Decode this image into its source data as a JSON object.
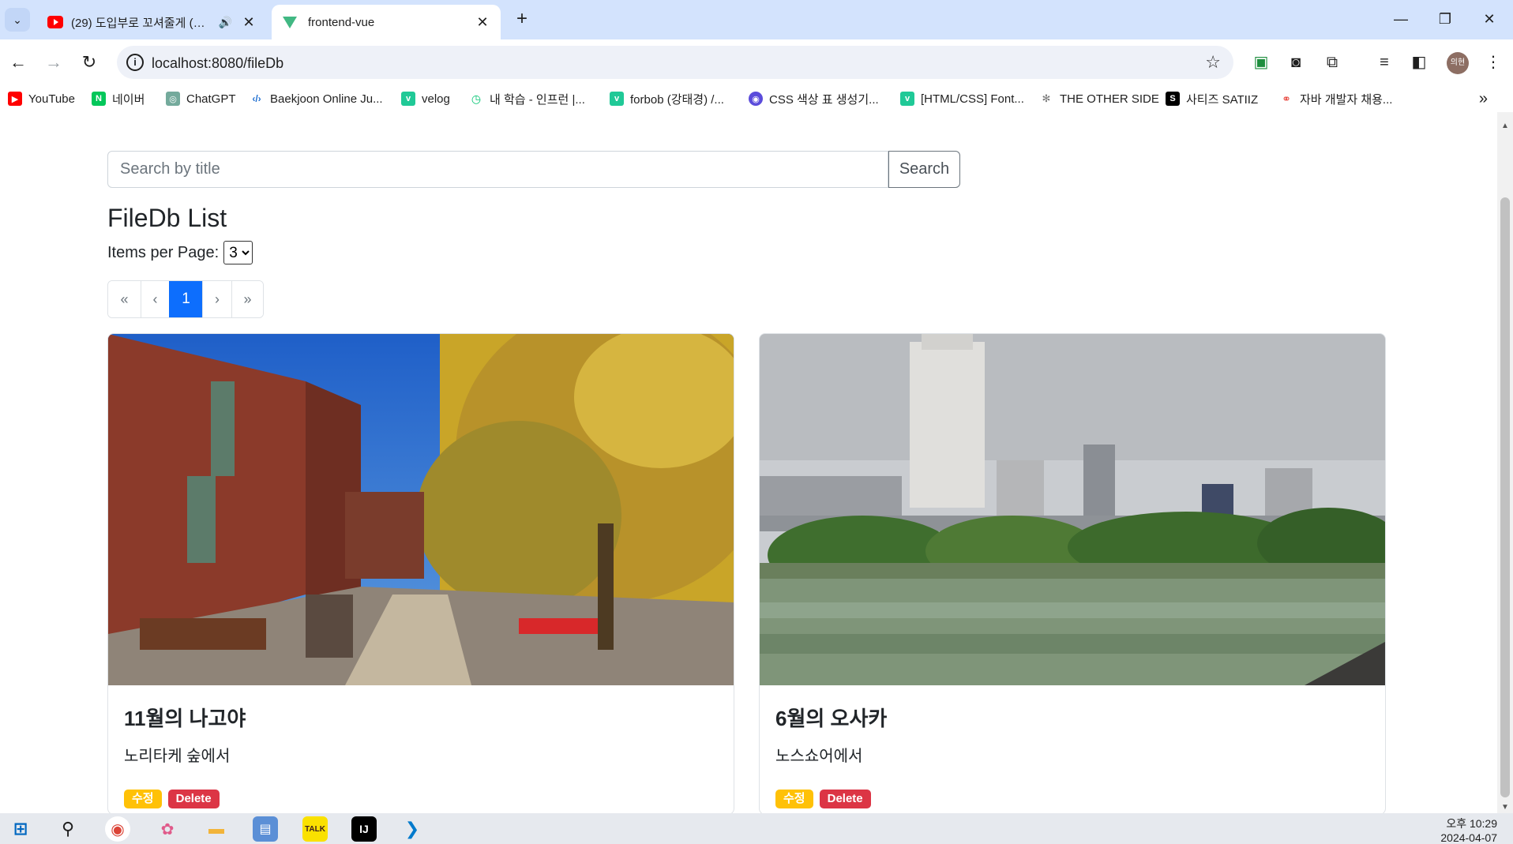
{
  "browser": {
    "tabs": [
      {
        "label": "(29) 도입부로 꼬셔줄게 (…",
        "favicon": "youtube-icon"
      },
      {
        "label": "frontend-vue",
        "favicon": "vue-icon"
      }
    ],
    "url": "localhost:8080/fileDb",
    "profile_initials": "의현",
    "bookmarks": [
      {
        "label": "YouTube",
        "icon": "youtube-icon",
        "color": "#ff0000",
        "glyph": "▶"
      },
      {
        "label": "네이버",
        "icon": "naver-icon",
        "color": "#03c75a",
        "glyph": "N"
      },
      {
        "label": "ChatGPT",
        "icon": "chatgpt-icon",
        "color": "#74aa9c",
        "glyph": "◎"
      },
      {
        "label": "Baekjoon Online Ju...",
        "icon": "code-icon",
        "color": "#ffffff",
        "glyph": "‹›"
      },
      {
        "label": "velog",
        "icon": "velog-icon",
        "color": "#20c997",
        "glyph": "v"
      },
      {
        "label": "내 학습 - 인프런 |...",
        "icon": "inflearn-icon",
        "color": "#00c471",
        "glyph": "◷"
      },
      {
        "label": "forbob (강태경) /...",
        "icon": "velog-icon",
        "color": "#20c997",
        "glyph": "v"
      },
      {
        "label": "CSS 색상 표 생성기...",
        "icon": "palette-icon",
        "color": "#5b4cdb",
        "glyph": "◉"
      },
      {
        "label": "[HTML/CSS] Font...",
        "icon": "velog-icon",
        "color": "#20c997",
        "glyph": "v"
      },
      {
        "label": "THE OTHER SIDE",
        "icon": "site-icon",
        "color": "#ffffff",
        "glyph": "✻"
      },
      {
        "label": "사티즈 SATIIZ",
        "icon": "satiiz-icon",
        "color": "#000000",
        "glyph": "S"
      },
      {
        "label": "자바 개발자 채용...",
        "icon": "jobs-icon",
        "color": "#ffffff",
        "glyph": "⚭"
      }
    ]
  },
  "page": {
    "search_placeholder": "Search by title",
    "search_button": "Search",
    "heading": "FileDb List",
    "items_per_page_label": "Items per Page:",
    "items_per_page_value": "3",
    "pagination": {
      "first": "«",
      "prev": "‹",
      "current": "1",
      "next": "›",
      "last": "»"
    },
    "cards": [
      {
        "title": "11월의 나고야",
        "description": "노리타케 숲에서",
        "edit_label": "수정",
        "delete_label": "Delete"
      },
      {
        "title": "6월의 오사카",
        "description": "노스쇼어에서",
        "edit_label": "수정",
        "delete_label": "Delete"
      }
    ]
  },
  "taskbar": {
    "time": "오후 10:29",
    "date": "2024-04-07"
  },
  "colors": {
    "primary": "#0d6efd",
    "warning": "#ffc107",
    "danger": "#dc3545"
  }
}
